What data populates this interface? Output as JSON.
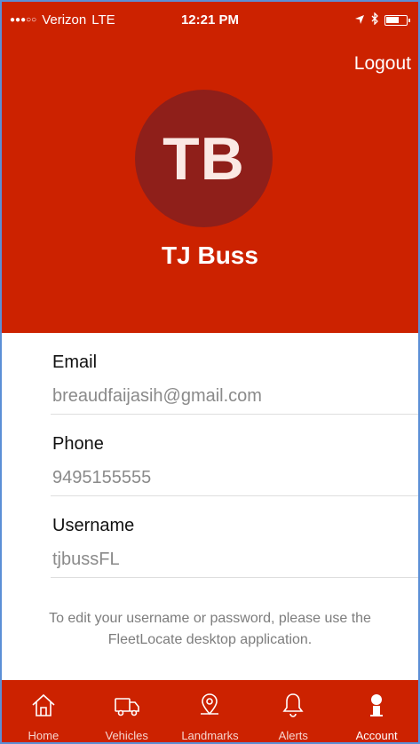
{
  "status_bar": {
    "carrier": "Verizon",
    "network": "LTE",
    "time": "12:21 PM"
  },
  "header": {
    "logout_label": "Logout",
    "avatar_initials": "TB",
    "user_name": "TJ Buss"
  },
  "fields": [
    {
      "label": "Email",
      "value": "breaudfaijasih@gmail.com"
    },
    {
      "label": "Phone",
      "value": "9495155555"
    },
    {
      "label": "Username",
      "value": "tjbussFL"
    }
  ],
  "note": "To edit your username or password, please use the FleetLocate desktop application.",
  "tabs": [
    {
      "label": "Home",
      "icon": "home-icon"
    },
    {
      "label": "Vehicles",
      "icon": "truck-icon"
    },
    {
      "label": "Landmarks",
      "icon": "map-pin-icon"
    },
    {
      "label": "Alerts",
      "icon": "bell-icon"
    },
    {
      "label": "Account",
      "icon": "person-icon"
    }
  ],
  "colors": {
    "brand_red": "#cc2200",
    "avatar_bg": "#8f1f1a"
  }
}
